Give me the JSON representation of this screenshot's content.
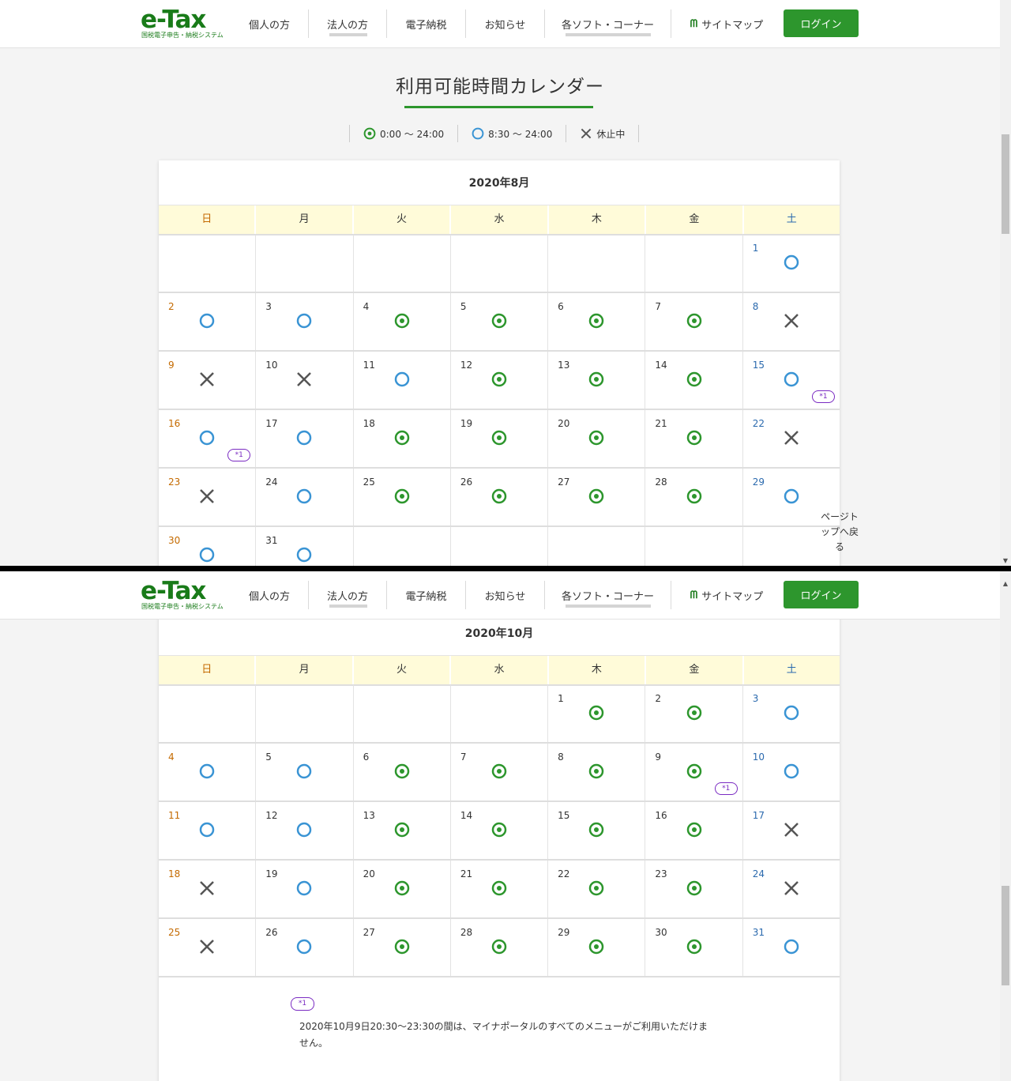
{
  "header": {
    "logo_main": "e-Tax",
    "logo_sub": "国税電子申告・納税システム",
    "nav": [
      "個人の方",
      "法人の方",
      "電子納税",
      "お知らせ",
      "各ソフト・コーナー",
      "サイトマップ"
    ],
    "login_label": "ログイン"
  },
  "page": {
    "title": "利用可能時間カレンダー",
    "legend": [
      {
        "icon": "double-circle-icon",
        "label": "0:00 ～ 24:00"
      },
      {
        "icon": "circle-icon",
        "label": "8:30 ～ 24:00"
      },
      {
        "icon": "cross-icon",
        "label": "休止中"
      }
    ],
    "weekdays": [
      "日",
      "月",
      "火",
      "水",
      "木",
      "金",
      "土"
    ],
    "pagetop_label": "ページトップへ戻る"
  },
  "colors": {
    "brand_green": "#2d962d",
    "circle_blue": "#3a94d4",
    "cross_gray": "#555555",
    "note_purple": "#7a2bc2",
    "header_row": "#fffbd9"
  },
  "calendars": {
    "aug": {
      "title": "2020年8月",
      "weeks": [
        [
          null,
          null,
          null,
          null,
          null,
          null,
          {
            "d": "1",
            "m": "o"
          }
        ],
        [
          {
            "d": "2",
            "m": "o"
          },
          {
            "d": "3",
            "m": "o"
          },
          {
            "d": "4",
            "m": "oo"
          },
          {
            "d": "5",
            "m": "oo"
          },
          {
            "d": "6",
            "m": "oo"
          },
          {
            "d": "7",
            "m": "oo"
          },
          {
            "d": "8",
            "m": "x"
          }
        ],
        [
          {
            "d": "9",
            "m": "x"
          },
          {
            "d": "10",
            "m": "x"
          },
          {
            "d": "11",
            "m": "o"
          },
          {
            "d": "12",
            "m": "oo"
          },
          {
            "d": "13",
            "m": "oo"
          },
          {
            "d": "14",
            "m": "oo"
          },
          {
            "d": "15",
            "m": "o",
            "note": "*1"
          }
        ],
        [
          {
            "d": "16",
            "m": "o",
            "note": "*1"
          },
          {
            "d": "17",
            "m": "o"
          },
          {
            "d": "18",
            "m": "oo"
          },
          {
            "d": "19",
            "m": "oo"
          },
          {
            "d": "20",
            "m": "oo"
          },
          {
            "d": "21",
            "m": "oo"
          },
          {
            "d": "22",
            "m": "x"
          }
        ],
        [
          {
            "d": "23",
            "m": "x"
          },
          {
            "d": "24",
            "m": "o"
          },
          {
            "d": "25",
            "m": "oo"
          },
          {
            "d": "26",
            "m": "oo"
          },
          {
            "d": "27",
            "m": "oo"
          },
          {
            "d": "28",
            "m": "oo"
          },
          {
            "d": "29",
            "m": "o"
          }
        ],
        [
          {
            "d": "30",
            "m": "o"
          },
          {
            "d": "31",
            "m": "o"
          },
          null,
          null,
          null,
          null,
          null
        ]
      ]
    },
    "oct": {
      "title": "2020年10月",
      "weeks": [
        [
          null,
          null,
          null,
          null,
          {
            "d": "1",
            "m": "oo"
          },
          {
            "d": "2",
            "m": "oo"
          },
          {
            "d": "3",
            "m": "o"
          }
        ],
        [
          {
            "d": "4",
            "m": "o"
          },
          {
            "d": "5",
            "m": "o"
          },
          {
            "d": "6",
            "m": "oo"
          },
          {
            "d": "7",
            "m": "oo"
          },
          {
            "d": "8",
            "m": "oo"
          },
          {
            "d": "9",
            "m": "oo",
            "note": "*1"
          },
          {
            "d": "10",
            "m": "o"
          }
        ],
        [
          {
            "d": "11",
            "m": "o"
          },
          {
            "d": "12",
            "m": "o"
          },
          {
            "d": "13",
            "m": "oo"
          },
          {
            "d": "14",
            "m": "oo"
          },
          {
            "d": "15",
            "m": "oo"
          },
          {
            "d": "16",
            "m": "oo"
          },
          {
            "d": "17",
            "m": "x"
          }
        ],
        [
          {
            "d": "18",
            "m": "x"
          },
          {
            "d": "19",
            "m": "o"
          },
          {
            "d": "20",
            "m": "oo"
          },
          {
            "d": "21",
            "m": "oo"
          },
          {
            "d": "22",
            "m": "oo"
          },
          {
            "d": "23",
            "m": "oo"
          },
          {
            "d": "24",
            "m": "x"
          }
        ],
        [
          {
            "d": "25",
            "m": "x"
          },
          {
            "d": "26",
            "m": "o"
          },
          {
            "d": "27",
            "m": "oo"
          },
          {
            "d": "28",
            "m": "oo"
          },
          {
            "d": "29",
            "m": "oo"
          },
          {
            "d": "30",
            "m": "oo"
          },
          {
            "d": "31",
            "m": "o"
          }
        ]
      ],
      "footnote_badge": "*1",
      "footnote_text": "2020年10月9日20:30～23:30の間は、マイナポータルのすべてのメニューがご利用いただけません。"
    }
  }
}
